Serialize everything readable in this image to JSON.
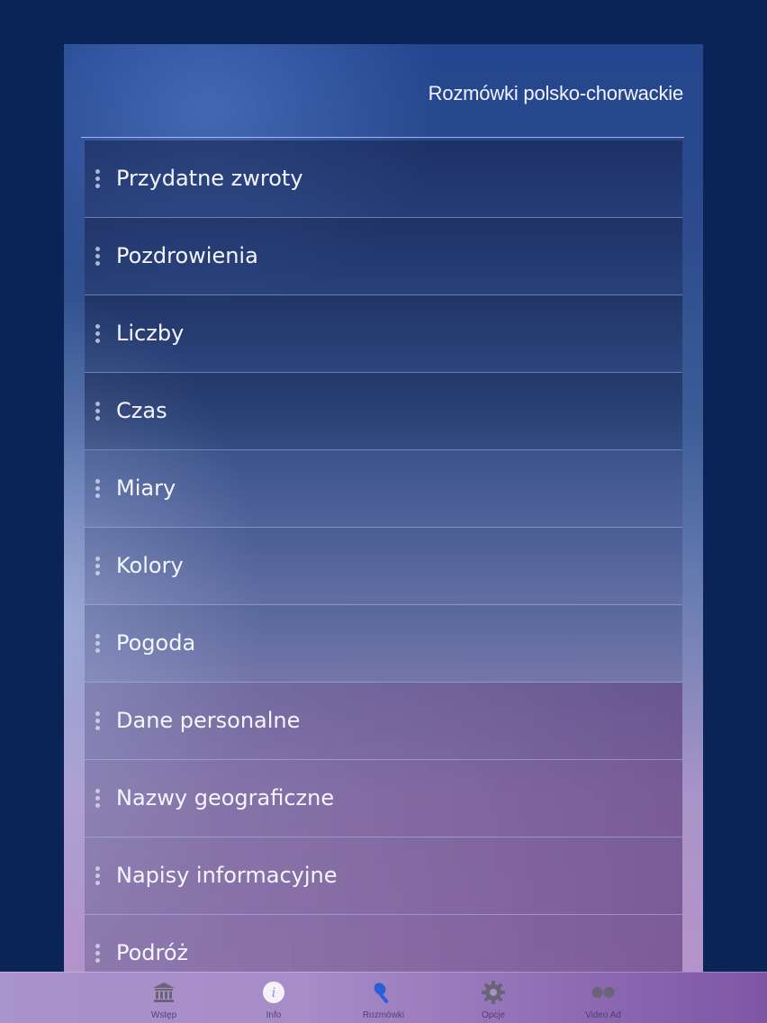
{
  "header": {
    "title": "Rozmówki polsko-chorwackie"
  },
  "list": {
    "items": [
      {
        "label": "Przydatne zwroty"
      },
      {
        "label": "Pozdrowienia"
      },
      {
        "label": "Liczby"
      },
      {
        "label": "Czas"
      },
      {
        "label": "Miary"
      },
      {
        "label": "Kolory"
      },
      {
        "label": "Pogoda"
      },
      {
        "label": "Dane personalne"
      },
      {
        "label": "Nazwy geograficzne"
      },
      {
        "label": "Napisy informacyjne"
      },
      {
        "label": "Podróż"
      }
    ]
  },
  "tabbar": {
    "tabs": [
      {
        "label": "Wstęp",
        "icon": "bank-icon"
      },
      {
        "label": "Info",
        "icon": "info-icon"
      },
      {
        "label": "Rozmówki",
        "icon": "microphone-icon",
        "active": true
      },
      {
        "label": "Opcje",
        "icon": "gear-icon"
      },
      {
        "label": "Video Ad",
        "icon": "video-ad-icon"
      }
    ]
  },
  "colors": {
    "background": "#0b2458",
    "active_tab": "#2a5fd8",
    "text": "#f4f6ff"
  }
}
